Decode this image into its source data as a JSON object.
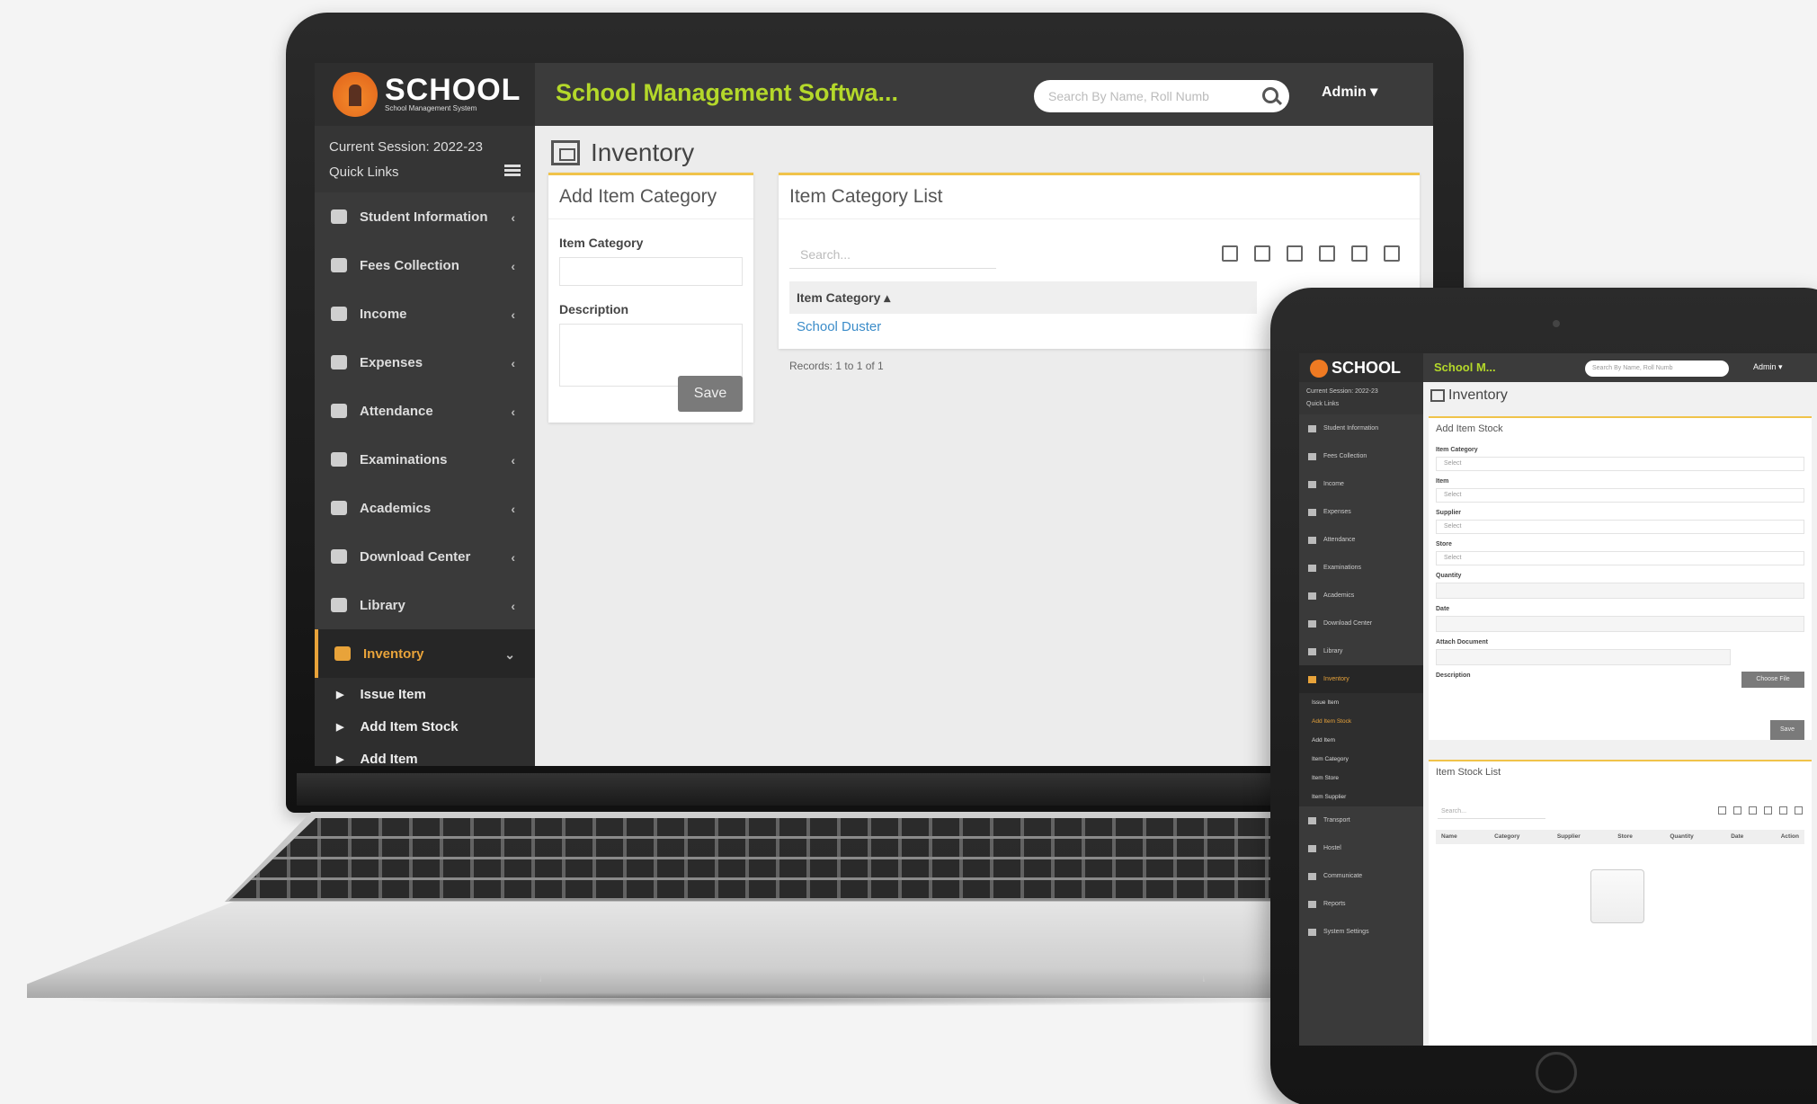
{
  "laptop": {
    "brand": "SCHOOL",
    "brand_sub": "School Management System",
    "app_title": "School Management Softwa...",
    "search_placeholder": "Search By Name, Roll Numb",
    "user": "Admin",
    "session": "Current Session: 2022-23",
    "quick_links": "Quick Links",
    "nav": [
      {
        "label": "Student Information",
        "icon": "user-icon"
      },
      {
        "label": "Fees Collection",
        "icon": "money-icon"
      },
      {
        "label": "Income",
        "icon": "dollar-icon"
      },
      {
        "label": "Expenses",
        "icon": "credit-card-icon"
      },
      {
        "label": "Attendance",
        "icon": "calendar-icon"
      },
      {
        "label": "Examinations",
        "icon": "map-icon"
      },
      {
        "label": "Academics",
        "icon": "graduation-cap-icon"
      },
      {
        "label": "Download Center",
        "icon": "download-icon"
      },
      {
        "label": "Library",
        "icon": "book-icon"
      },
      {
        "label": "Inventory",
        "icon": "inventory-icon"
      }
    ],
    "sub_nav": [
      "Issue Item",
      "Add Item Stock",
      "Add Item"
    ],
    "page_title": "Inventory",
    "form": {
      "title": "Add Item Category",
      "category_label": "Item Category",
      "description_label": "Description",
      "save": "Save"
    },
    "list": {
      "title": "Item Category List",
      "search_placeholder": "Search...",
      "column": "Item Category",
      "rows": [
        "School Duster"
      ],
      "records": "Records: 1 to 1 of 1"
    }
  },
  "tablet": {
    "brand": "SCHOOL",
    "app_title": "School M...",
    "search_placeholder": "Search By Name, Roll Numb",
    "user": "Admin",
    "session": "Current Session: 2022-23",
    "quick_links": "Quick Links",
    "nav_top": [
      "Student Information",
      "Fees Collection",
      "Income",
      "Expenses",
      "Attendance",
      "Examinations",
      "Academics",
      "Download Center",
      "Library",
      "Inventory"
    ],
    "sub_nav": [
      "Issue Item",
      "Add Item Stock",
      "Add Item",
      "Item Category",
      "Item Store",
      "Item Supplier"
    ],
    "nav_bottom": [
      "Transport",
      "Hostel",
      "Communicate",
      "Reports",
      "System Settings"
    ],
    "page_title": "Inventory",
    "form": {
      "title": "Add Item Stock",
      "item_category": "Item Category",
      "item": "Item",
      "supplier": "Supplier",
      "store": "Store",
      "quantity": "Quantity",
      "date": "Date",
      "attach": "Attach Document",
      "choose_file": "Choose File",
      "description": "Description",
      "select": "Select",
      "save": "Save"
    },
    "list": {
      "title": "Item Stock List",
      "search_placeholder": "Search...",
      "columns": [
        "Name",
        "Category",
        "Supplier",
        "Store",
        "Quantity",
        "Date",
        "Action"
      ]
    }
  }
}
